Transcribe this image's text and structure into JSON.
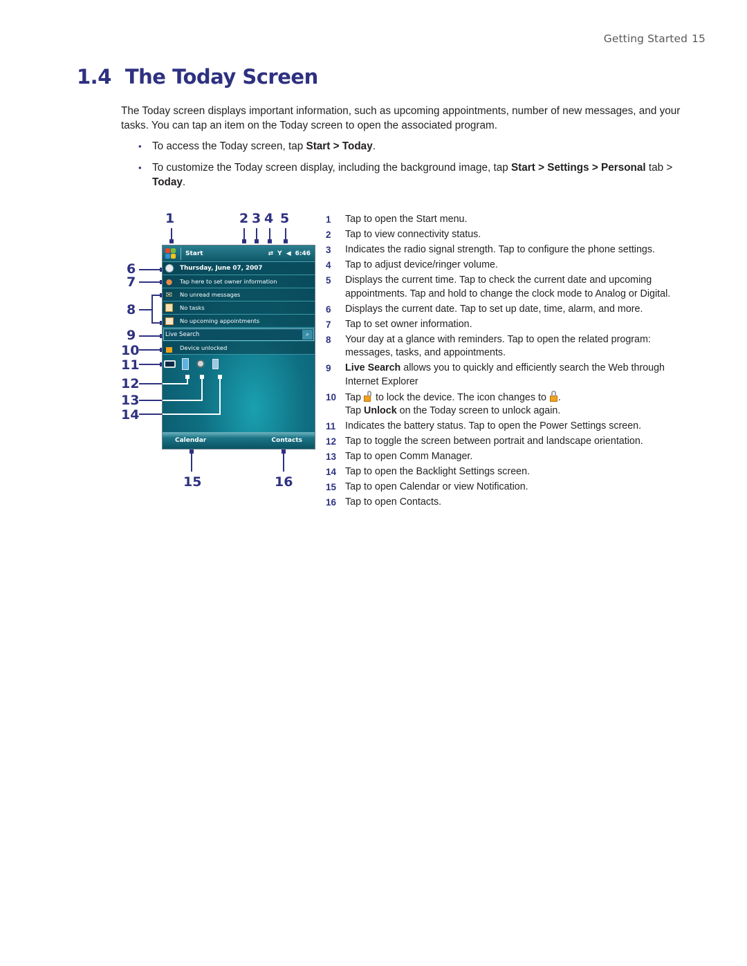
{
  "header": {
    "section": "Getting Started",
    "page_number": "15"
  },
  "title": {
    "number": "1.4",
    "text": "The Today Screen"
  },
  "intro": "The Today screen displays important information, such as upcoming appointments, number of new messages, and your tasks. You can tap an item on the Today screen to open the associated program.",
  "bullets": [
    {
      "pre": "To access the Today screen, tap ",
      "b1": "Start > Today",
      "post": "."
    },
    {
      "pre": "To customize the Today screen display, including the background image, tap ",
      "b1": "Start > Settings > Personal",
      "mid": " tab > ",
      "b2": "Today",
      "post": "."
    }
  ],
  "figure": {
    "callouts": [
      "1",
      "2",
      "3",
      "4",
      "5",
      "6",
      "7",
      "8",
      "9",
      "10",
      "11",
      "12",
      "13",
      "14",
      "15",
      "16"
    ],
    "titlebar": {
      "start_label": "Start",
      "time": "6:46",
      "connectivity_icon": "⇄",
      "signal_icon": "Y",
      "volume_icon": "◀"
    },
    "rows": {
      "date": "Thursday, June 07, 2007",
      "owner": "Tap here to set owner information",
      "messages": "No unread messages",
      "tasks": "No tasks",
      "appointments": "No upcoming appointments",
      "search": "Live Search",
      "lock": "Device unlocked"
    },
    "softkeys": {
      "left": "Calendar",
      "right": "Contacts"
    }
  },
  "legend": [
    {
      "num": "1",
      "text": "Tap to open the Start menu."
    },
    {
      "num": "2",
      "text": "Tap to view connectivity status."
    },
    {
      "num": "3",
      "text": "Indicates the radio signal strength. Tap to configure the phone settings."
    },
    {
      "num": "4",
      "text": "Tap to adjust device/ringer volume."
    },
    {
      "num": "5",
      "text": "Displays the current time. Tap to check the current date and upcoming appointments. Tap and hold to change the clock mode to Analog or Digital."
    },
    {
      "num": "6",
      "text": "Displays the current date. Tap to set up date, time, alarm, and more."
    },
    {
      "num": "7",
      "text": "Tap to set owner information."
    },
    {
      "num": "8",
      "text": "Your day at a glance with reminders. Tap to open the related program: messages, tasks, and appointments."
    },
    {
      "num": "9",
      "bold": "Live Search",
      "text": " allows you to quickly and efficiently search the Web through Internet Explorer"
    },
    {
      "num": "10",
      "t1": "Tap ",
      "t2": " to lock the device. The icon changes to ",
      "t3": ".",
      "t4": "Tap ",
      "bold": "Unlock",
      "t5": " on the Today screen to unlock again."
    },
    {
      "num": "11",
      "text": "Indicates the battery status. Tap to open the Power Settings screen."
    },
    {
      "num": "12",
      "text": "Tap to toggle the screen between portrait and landscape orientation."
    },
    {
      "num": "13",
      "text": "Tap to open Comm Manager."
    },
    {
      "num": "14",
      "text": "Tap to open the Backlight Settings screen."
    },
    {
      "num": "15",
      "text": "Tap to open Calendar or view Notification."
    },
    {
      "num": "16",
      "text": "Tap to open Contacts."
    }
  ],
  "colors": {
    "accent": "#2e3180",
    "header_gray": "#58595b",
    "screen_teal": "#0f6f82"
  }
}
